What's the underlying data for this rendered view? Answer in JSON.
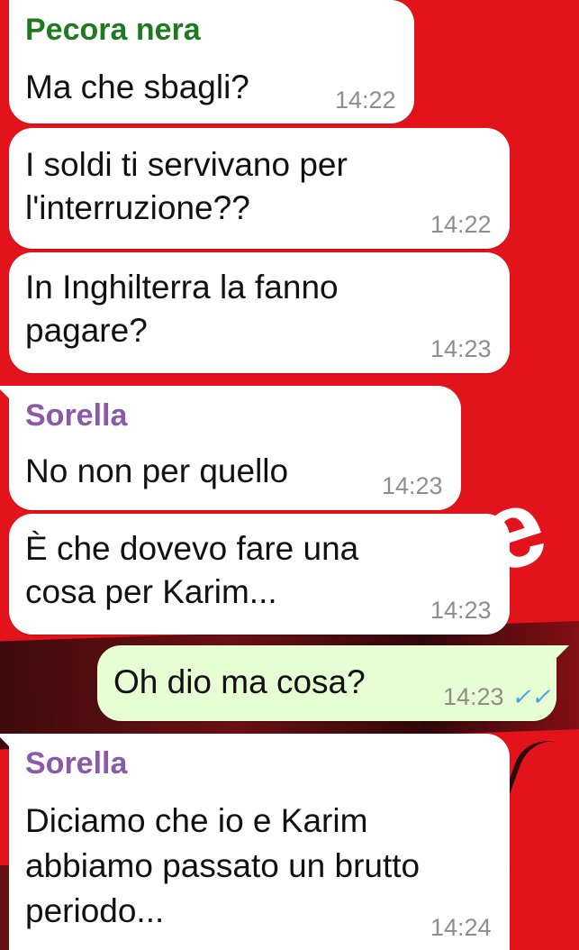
{
  "colors": {
    "background": "#e3131b",
    "incoming_bubble": "#ffffff",
    "outgoing_bubble": "#e7fdd4",
    "sender_pecora": "#1f7a1f",
    "sender_sorella": "#8a5aa8",
    "timestamp": "#8e8e8e",
    "read_ticks": "#4aa3e8"
  },
  "messages": [
    {
      "sender": "Pecora nera",
      "lines": [
        "Ma che sbagli?"
      ],
      "time": "14:22"
    },
    {
      "lines": [
        "I soldi ti servivano per",
        "l'interruzione??"
      ],
      "time": "14:22"
    },
    {
      "lines": [
        "In Inghilterra la fanno",
        "pagare?"
      ],
      "time": "14:23"
    },
    {
      "sender": "Sorella",
      "lines": [
        "No non per quello"
      ],
      "time": "14:23"
    },
    {
      "lines": [
        "È che dovevo fare una",
        "cosa per Karim..."
      ],
      "time": "14:23"
    },
    {
      "lines": [
        "Oh dio ma cosa?"
      ],
      "time": "14:23",
      "status": "read-ticks-icon"
    },
    {
      "sender": "Sorella",
      "lines": [
        "Diciamo che io e Karim",
        "abbiamo passato un brutto",
        "periodo..."
      ],
      "time": "14:24"
    }
  ],
  "read_ticks_glyph": "✓✓"
}
